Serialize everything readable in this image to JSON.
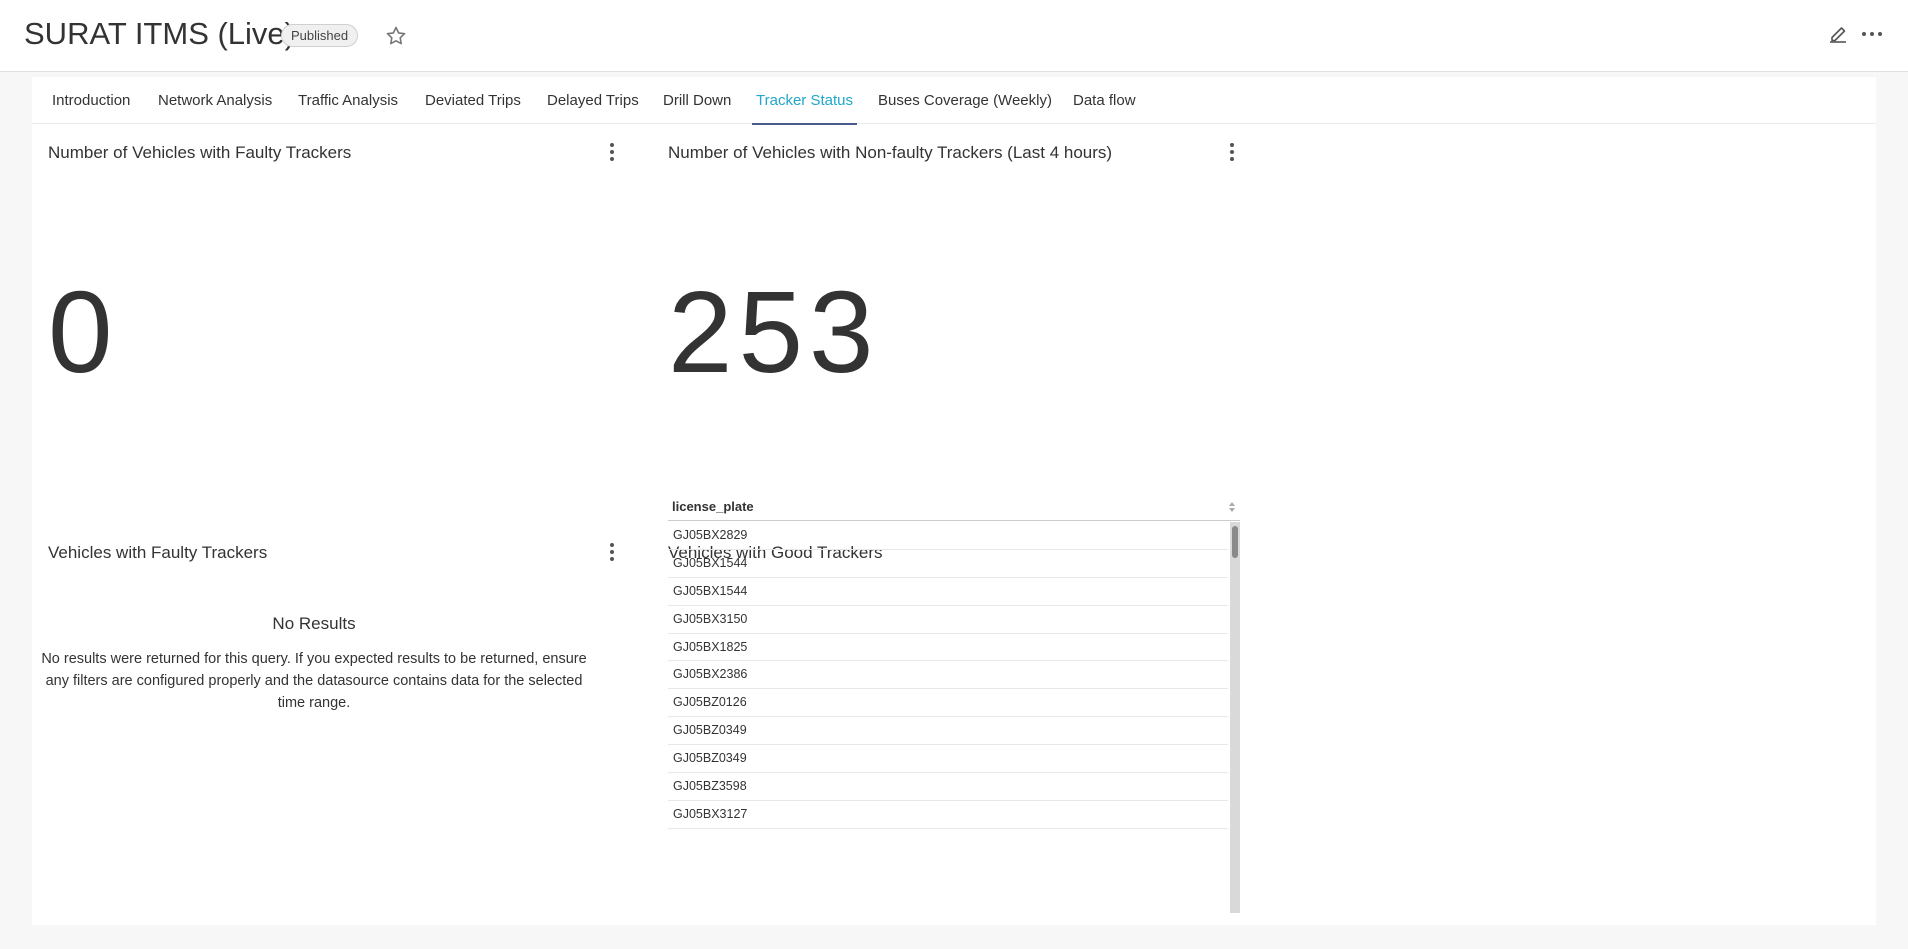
{
  "header": {
    "title": "SURAT ITMS (Live)",
    "badge": "Published",
    "icons": [
      "star-icon",
      "edit-icon",
      "more-icon"
    ]
  },
  "tabs": [
    {
      "label": "Introduction"
    },
    {
      "label": "Network Analysis"
    },
    {
      "label": "Traffic Analysis"
    },
    {
      "label": "Deviated Trips"
    },
    {
      "label": "Delayed Trips"
    },
    {
      "label": "Drill Down"
    },
    {
      "label": "Tracker Status",
      "active": true
    },
    {
      "label": "Buses Coverage (Weekly)"
    },
    {
      "label": "Data flow"
    }
  ],
  "charts": {
    "faulty_count": {
      "title": "Number of Vehicles with Faulty Trackers",
      "value": "0"
    },
    "nonfaulty_count": {
      "title": "Number of Vehicles with Non-faulty Trackers (Last 4 hours)",
      "value": "253"
    },
    "faulty_table": {
      "title": "Vehicles with Faulty Trackers",
      "empty_title": "No Results",
      "empty_text": "No results were returned for this query. If you expected results to be returned, ensure any filters are configured properly and the datasource contains data for the selected time range."
    },
    "good_table": {
      "title": "Vehicles with Good Trackers",
      "column": "license_plate",
      "rows": [
        "GJ05BX2829",
        "GJ05BX1544",
        "GJ05BX1544",
        "GJ05BX3150",
        "GJ05BX1825",
        "GJ05BX2386",
        "GJ05BZ0126",
        "GJ05BZ0349",
        "GJ05BZ0349",
        "GJ05BZ3598",
        "GJ05BX3127"
      ]
    }
  },
  "colors": {
    "active_tab": "#20a7c9",
    "tab_underline": "#4a5a8a"
  }
}
